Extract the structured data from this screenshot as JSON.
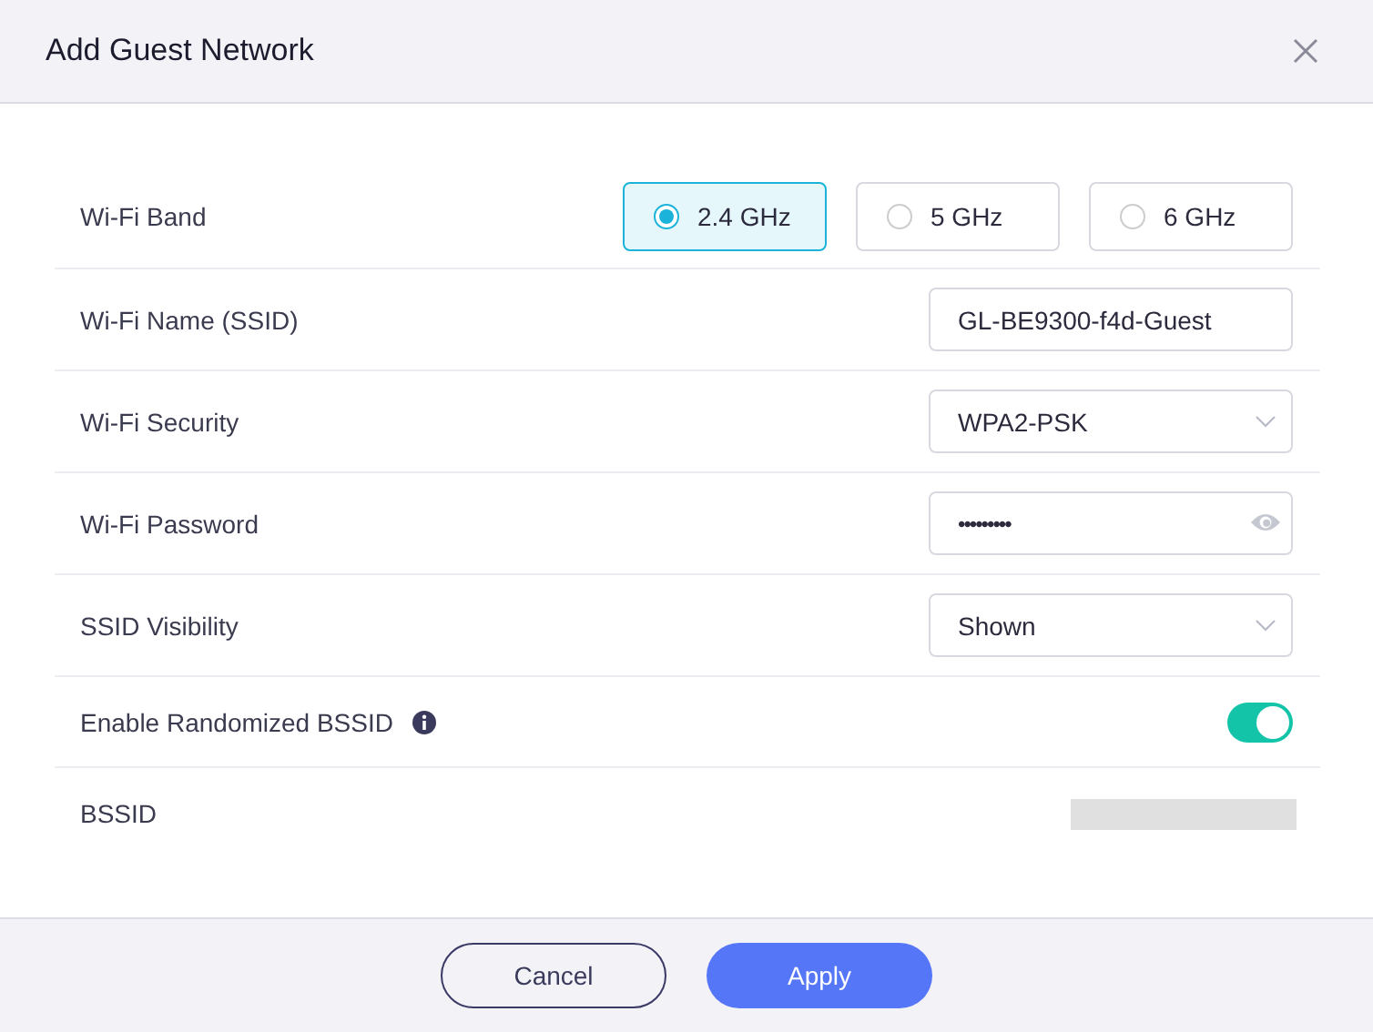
{
  "window": {
    "title": "Add Guest Network"
  },
  "rows": [
    {
      "kind": "radio",
      "label": "Wi-Fi Band",
      "options": [
        {
          "label": "2.4 GHz",
          "selected": true
        },
        {
          "label": "5 GHz",
          "selected": false
        },
        {
          "label": "6 GHz",
          "selected": false
        }
      ]
    },
    {
      "kind": "text",
      "label": "Wi-Fi Name (SSID)",
      "value": "GL-BE9300-f4d-Guest"
    },
    {
      "kind": "select",
      "label": "Wi-Fi Security",
      "value": "WPA2-PSK"
    },
    {
      "kind": "password",
      "label": "Wi-Fi Password",
      "value": "•••••••••"
    },
    {
      "kind": "select",
      "label": "SSID Visibility",
      "value": "Shown"
    },
    {
      "kind": "toggle",
      "label": "Enable Randomized BSSID",
      "info": true,
      "on": true
    },
    {
      "kind": "blank",
      "label": "BSSID"
    }
  ],
  "buttons": [
    {
      "label": "Cancel",
      "kind": "secondary"
    },
    {
      "label": "Apply",
      "kind": "primary"
    }
  ]
}
